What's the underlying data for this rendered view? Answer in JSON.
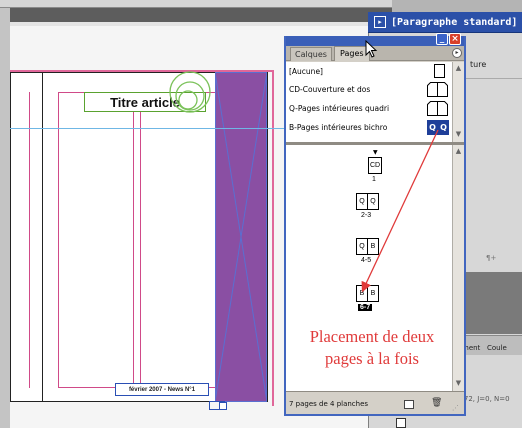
{
  "canvas": {
    "title_article": "Titre article",
    "footer": "février 2007 - News N°1"
  },
  "background_panel": {
    "header": "[Paragraphe standard]",
    "peek_text": "ture",
    "tab_ment": "ment",
    "tab_couleur": "Coule",
    "coord_peek": "=72, J=0, N=0",
    "para_peek": "¶+"
  },
  "pages_panel": {
    "tabs": [
      {
        "label": "Calques"
      },
      {
        "label": "Pages"
      }
    ],
    "masters": [
      {
        "label": "[Aucune]",
        "icon": "single-page"
      },
      {
        "label": "CD-Couverture et dos",
        "icon": "spread-blank"
      },
      {
        "label": "Q-Pages intérieures quadri",
        "icon": "spread-blank"
      },
      {
        "label": "B-Pages intérieures bichro",
        "icon_left": "Q",
        "icon_right": "Q"
      }
    ],
    "pages": [
      {
        "letters": [
          "CD"
        ],
        "number": "1"
      },
      {
        "letters": [
          "Q",
          "Q"
        ],
        "number": "2-3"
      },
      {
        "letters": [
          "Q",
          "B"
        ],
        "number": "4-5"
      },
      {
        "letters": [
          "B",
          "B"
        ],
        "number": "6-7"
      }
    ],
    "status": "7 pages de 4 planches",
    "menu_icon": "triangle-right-icon",
    "trash_icon": "trash-icon"
  },
  "annotation": {
    "line1": "Placement de deux",
    "line2": "pages à la fois"
  },
  "colors": {
    "panel_blue": "#3a5fb8",
    "close_red": "#d8402a",
    "annotation_red": "#e03a3a",
    "image_purple": "#8a4fa3",
    "bleed_pink": "#e0679a",
    "frame_green": "#5aa22f",
    "selected_master_blue": "#1f3f99"
  }
}
